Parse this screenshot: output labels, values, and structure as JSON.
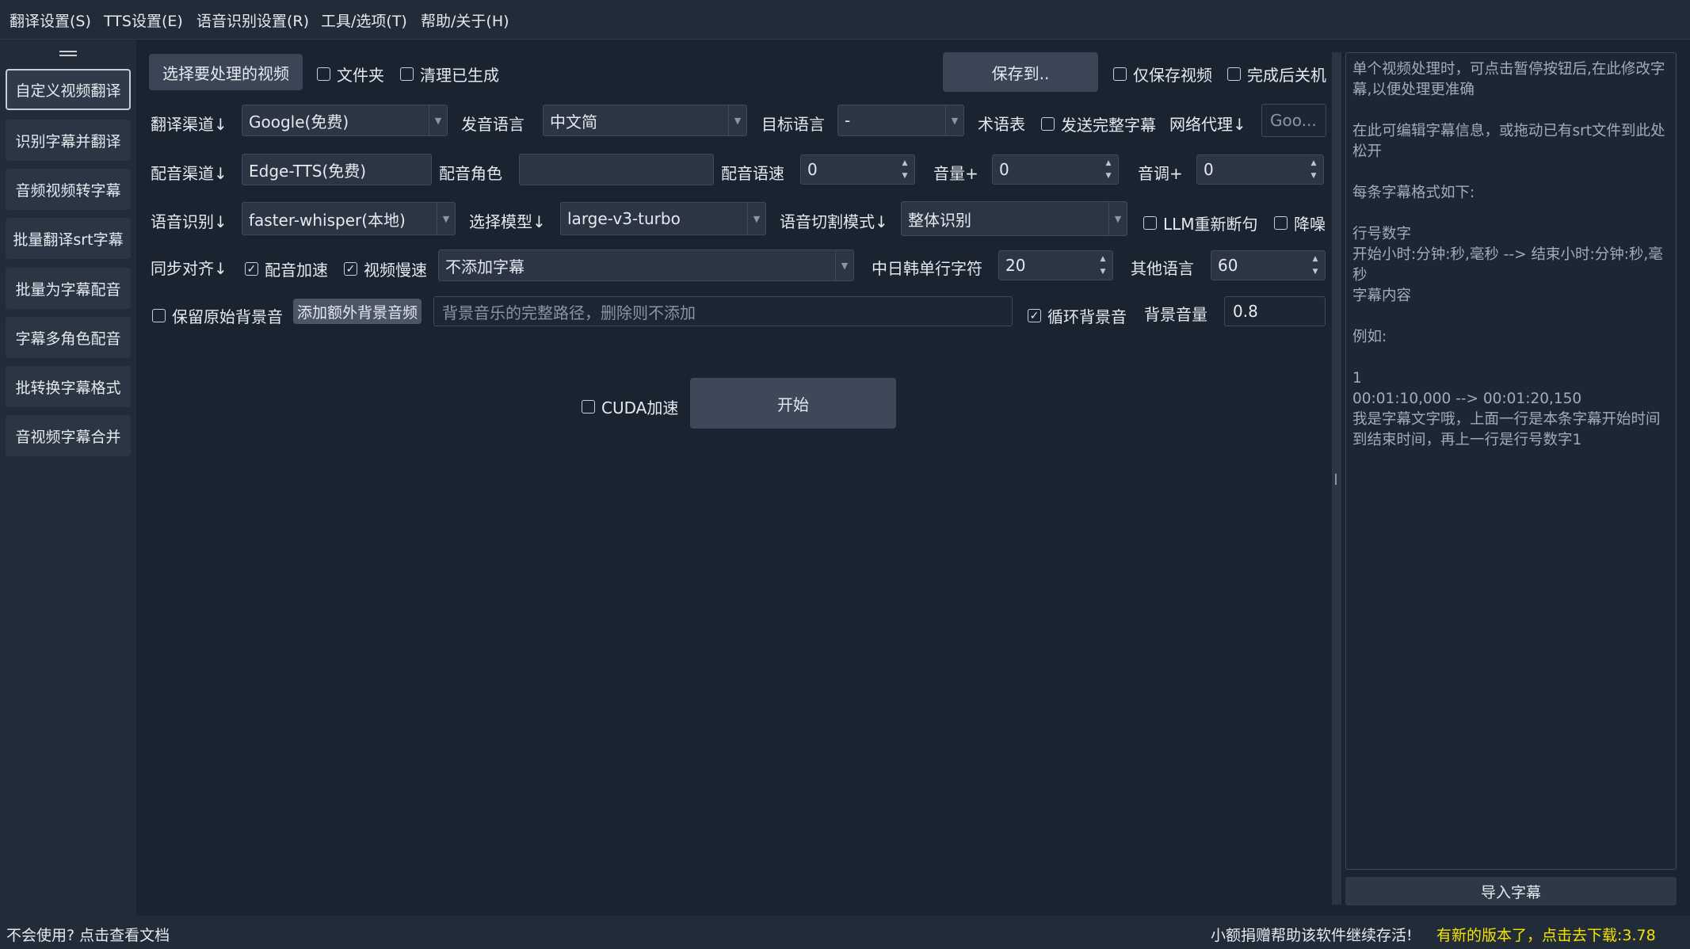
{
  "menu": [
    "翻译设置(S)",
    "TTS设置(E)",
    "语音识别设置(R)",
    "工具/选项(T)",
    "帮助/关于(H)"
  ],
  "sidebar": {
    "items": [
      {
        "label": "自定义视频翻译",
        "active": true
      },
      {
        "label": "识别字幕并翻译",
        "active": false
      },
      {
        "label": "音频视频转字幕",
        "active": false
      },
      {
        "label": "批量翻译srt字幕",
        "active": false
      },
      {
        "label": "批量为字幕配音",
        "active": false
      },
      {
        "label": "字幕多角色配音",
        "active": false
      },
      {
        "label": "批转换字幕格式",
        "active": false
      },
      {
        "label": "音视频字幕合并",
        "active": false
      }
    ]
  },
  "row1": {
    "select_video": "选择要处理的视频",
    "folder": {
      "label": "文件夹",
      "checked": false
    },
    "clean": {
      "label": "清理已生成",
      "checked": false
    },
    "save_to": "保存到..",
    "only_save_video": {
      "label": "仅保存视频",
      "checked": false
    },
    "shutdown": {
      "label": "完成后关机",
      "checked": false
    }
  },
  "row2": {
    "translate_channel_label": "翻译渠道↓",
    "translate_channel_value": "Google(免费)",
    "source_lang_label": "发音语言",
    "source_lang_value": "中文简",
    "target_lang_label": "目标语言",
    "target_lang_value": "-",
    "glossary": "术语表",
    "send_full": {
      "label": "发送完整字幕",
      "checked": false
    },
    "proxy_label": "网络代理↓",
    "proxy_value": "Goo..."
  },
  "row3": {
    "dub_channel_label": "配音渠道↓",
    "dub_channel_value": "Edge-TTS(免费)",
    "role_label": "配音角色",
    "role_value": "",
    "speed_label": "配音语速",
    "speed_value": "0",
    "volume_label": "音量+",
    "volume_value": "0",
    "pitch_label": "音调+",
    "pitch_value": "0"
  },
  "row4": {
    "asr_label": "语音识别↓",
    "asr_value": "faster-whisper(本地)",
    "model_label": "选择模型↓",
    "model_value": "large-v3-turbo",
    "split_label": "语音切割模式↓",
    "split_value": "整体识别",
    "llm": {
      "label": "LLM重新断句",
      "checked": false
    },
    "denoise": {
      "label": "降噪",
      "checked": false
    }
  },
  "row5": {
    "sync_label": "同步对齐↓",
    "dub_accel": {
      "label": "配音加速",
      "checked": true
    },
    "video_slow": {
      "label": "视频慢速",
      "checked": true
    },
    "subtitle_mode": "不添加字幕",
    "cjk_label": "中日韩单行字符",
    "cjk_value": "20",
    "other_label": "其他语言",
    "other_value": "60"
  },
  "row6": {
    "keep_bg": {
      "label": "保留原始背景音",
      "checked": false
    },
    "add_bg_button": "添加额外背景音频",
    "bg_path_placeholder": "背景音乐的完整路径，删除则不添加",
    "loop_bg": {
      "label": "循环背景音",
      "checked": true
    },
    "bg_volume_label": "背景音量",
    "bg_volume_value": "0.8"
  },
  "start": {
    "cuda": {
      "label": "CUDA加速",
      "checked": false
    },
    "button": "开始"
  },
  "help_panel": {
    "lines": [
      "单个视频处理时，可点击暂停按钮后,在此修改字幕,以便处理更准确",
      "",
      " 在此可编辑字幕信息，或拖动已有srt文件到此处松开",
      "",
      "每条字幕格式如下:",
      "",
      "行号数字",
      "开始小时:分钟:秒,毫秒 --> 结束小时:分钟:秒,毫秒",
      "字幕内容",
      "",
      "例如:",
      "",
      "1",
      "00:01:10,000 --> 00:01:20,150",
      "我是字幕文字哦，上面一行是本条字幕开始时间到结束时间，再上一行是行号数字1"
    ],
    "import_button": "导入字幕"
  },
  "status": {
    "help_link": "不会使用? 点击查看文档",
    "donate": "小额捐赠帮助该软件继续存活!",
    "update": "有新的版本了，点击去下载:3.78",
    "update_color": "#f5e400"
  }
}
